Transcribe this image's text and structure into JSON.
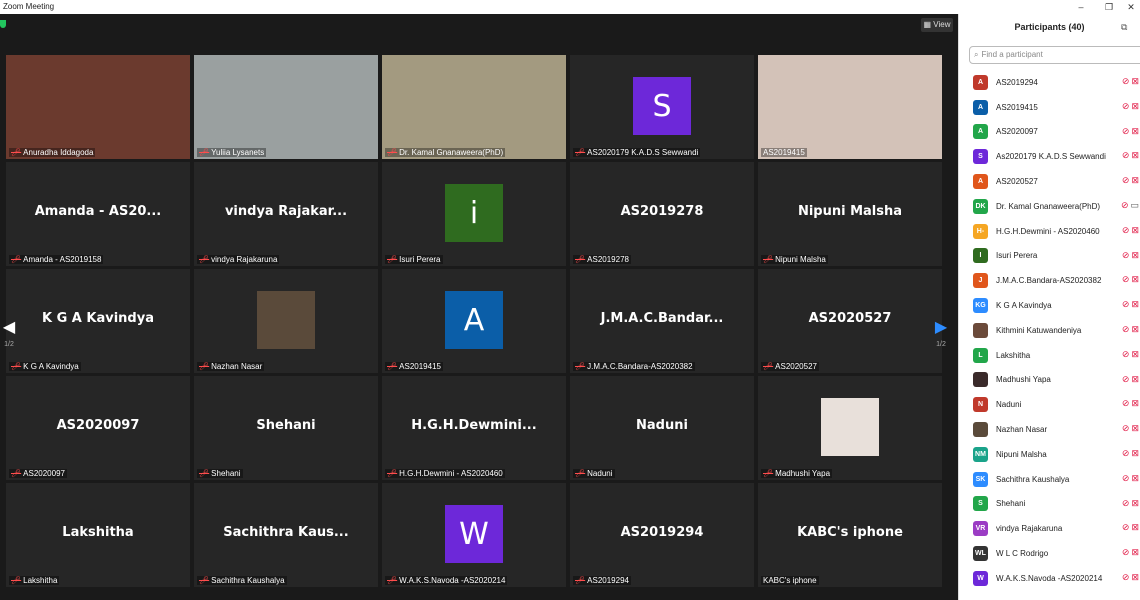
{
  "window": {
    "title": "Zoom Meeting",
    "minimize": "–",
    "restore": "❐",
    "close": "✕"
  },
  "toolbar": {
    "view_label": "View"
  },
  "nav": {
    "page_left": "1/2",
    "page_right": "1/2"
  },
  "tiles": [
    {
      "caption": "Anuradha Iddagoda",
      "type": "video",
      "bg": "#6b3a2e"
    },
    {
      "caption": "Yuliia Lysanets",
      "type": "video",
      "bg": "#9aa0a0",
      "active": true
    },
    {
      "caption": "Dr. Kamal Gnanaweera(PhD)",
      "type": "video",
      "bg": "#a39a80"
    },
    {
      "caption": "AS2020179 K.A.D.S Sewwandi",
      "type": "avatar",
      "letter": "S",
      "color": "#6d28d9"
    },
    {
      "caption": "AS2019415",
      "type": "video",
      "bg": "#d3c2b8",
      "nomic": true
    },
    {
      "caption": "Amanda - AS2019158",
      "type": "name",
      "big": "Amanda - AS20..."
    },
    {
      "caption": "vindya Rajakaruna",
      "type": "name",
      "big": "vindya Rajakar..."
    },
    {
      "caption": "Isuri Perera",
      "type": "avatar",
      "letter": "i",
      "color": "#2f6b1f"
    },
    {
      "caption": "AS2019278",
      "type": "name",
      "big": "AS2019278"
    },
    {
      "caption": "Nipuni Malsha",
      "type": "name",
      "big": "Nipuni Malsha"
    },
    {
      "caption": "K G A Kavindya",
      "type": "name",
      "big": "K G A Kavindya"
    },
    {
      "caption": "Nazhan Nasar",
      "type": "photo",
      "color": "#5a4a3a"
    },
    {
      "caption": "AS2019415",
      "type": "avatar",
      "letter": "A",
      "color": "#0b5ea8"
    },
    {
      "caption": "J.M.A.C.Bandara-AS2020382",
      "type": "name",
      "big": "J.M.A.C.Bandar..."
    },
    {
      "caption": "AS2020527",
      "type": "name",
      "big": "AS2020527"
    },
    {
      "caption": "AS2020097",
      "type": "name",
      "big": "AS2020097"
    },
    {
      "caption": "Shehani",
      "type": "name",
      "big": "Shehani"
    },
    {
      "caption": "H.G.H.Dewmini - AS2020460",
      "type": "name",
      "big": "H.G.H.Dewmini..."
    },
    {
      "caption": "Naduni",
      "type": "name",
      "big": "Naduni"
    },
    {
      "caption": "Madhushi Yapa",
      "type": "photo",
      "color": "#e8e0da"
    },
    {
      "caption": "Lakshitha",
      "type": "name",
      "big": "Lakshitha"
    },
    {
      "caption": "Sachithra Kaushalya",
      "type": "name",
      "big": "Sachithra  Kaus..."
    },
    {
      "caption": "W.A.K.S.Navoda -AS2020214",
      "type": "avatar",
      "letter": "W",
      "color": "#6d28d9"
    },
    {
      "caption": "AS2019294",
      "type": "name",
      "big": "AS2019294"
    },
    {
      "caption": "KABC's iphone",
      "type": "name",
      "big": "KABC's iphone",
      "nomic": true
    }
  ],
  "panel": {
    "title": "Participants (40)",
    "search_placeholder": "Find a participant",
    "popout_icon": "⧉",
    "participants": [
      {
        "name": "AS2019294",
        "initials": "A",
        "color": "#c0392b"
      },
      {
        "name": "AS2019415",
        "initials": "A",
        "color": "#0b5ea8"
      },
      {
        "name": "AS2020097",
        "initials": "A",
        "color": "#22a64a"
      },
      {
        "name": "As2020179 K.A.D.S Sewwandi",
        "initials": "S",
        "color": "#6d28d9"
      },
      {
        "name": "AS2020527",
        "initials": "A",
        "color": "#e0561b"
      },
      {
        "name": "Dr. Kamal Gnanaweera(PhD)",
        "initials": "DK",
        "color": "#22a64a",
        "video_on": true
      },
      {
        "name": "H.G.H.Dewmini - AS2020460",
        "initials": "H-",
        "color": "#f5a623"
      },
      {
        "name": "Isuri Perera",
        "initials": "I",
        "color": "#2f6b1f"
      },
      {
        "name": "J.M.A.C.Bandara-AS2020382",
        "initials": "J",
        "color": "#e0561b"
      },
      {
        "name": "K G A Kavindya",
        "initials": "KG",
        "color": "#2d8cff"
      },
      {
        "name": "Kithmini Katuwandeniya",
        "initials": "",
        "color": "#6b4a3a"
      },
      {
        "name": "Lakshitha",
        "initials": "L",
        "color": "#22a64a"
      },
      {
        "name": "Madhushi Yapa",
        "initials": "",
        "color": "#3a2a2a"
      },
      {
        "name": "Naduni",
        "initials": "N",
        "color": "#c0392b"
      },
      {
        "name": "Nazhan Nasar",
        "initials": "",
        "color": "#5a4a3a"
      },
      {
        "name": "Nipuni Malsha",
        "initials": "NM",
        "color": "#1aa38a"
      },
      {
        "name": "Sachithra Kaushalya",
        "initials": "SK",
        "color": "#2d8cff"
      },
      {
        "name": "Shehani",
        "initials": "S",
        "color": "#22a64a"
      },
      {
        "name": "vindya Rajakaruna",
        "initials": "VR",
        "color": "#9b3cc4"
      },
      {
        "name": "W L C Rodrigo",
        "initials": "WL",
        "color": "#333333"
      },
      {
        "name": "W.A.K.S.Navoda -AS2020214",
        "initials": "W",
        "color": "#6d28d9"
      }
    ]
  }
}
